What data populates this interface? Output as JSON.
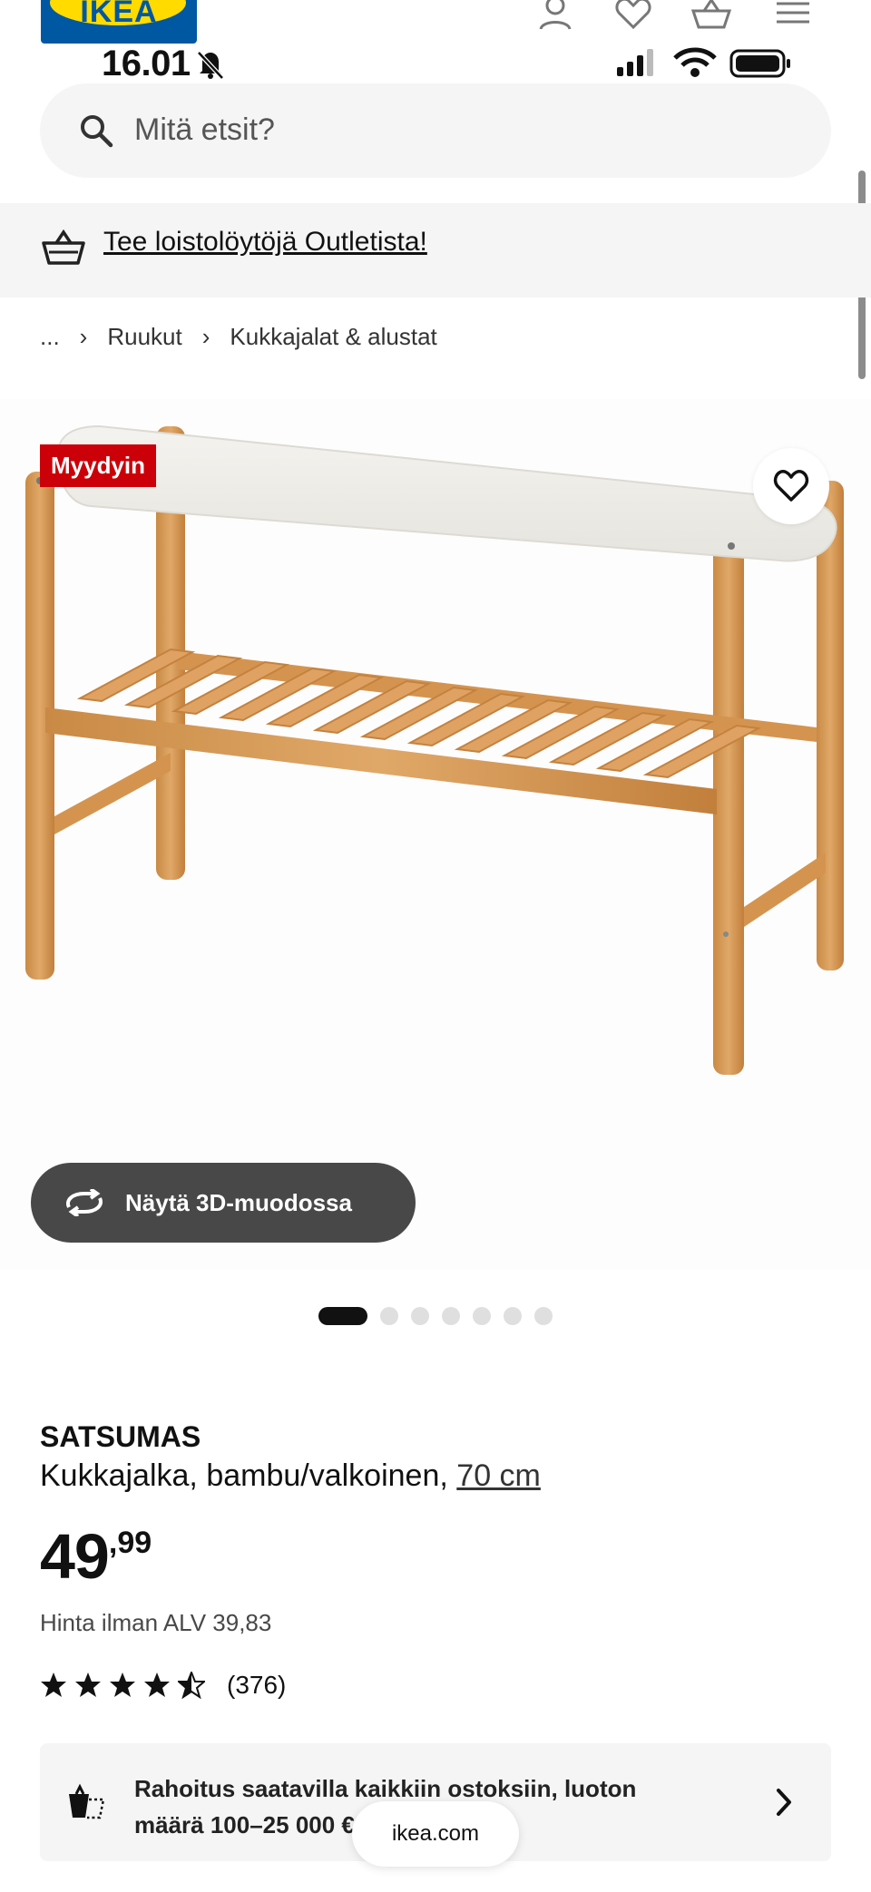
{
  "status_bar": {
    "time": "16.01"
  },
  "header": {
    "logo_text": "IKEA"
  },
  "search": {
    "placeholder": "Mitä etsit?"
  },
  "promo": {
    "text": "Tee loistolöytöjä Outletista!"
  },
  "breadcrumb": {
    "items": [
      "...",
      "Ruukut",
      "Kukkajalat & alustat"
    ]
  },
  "gallery": {
    "badge": "Myydyin",
    "view_3d_label": "Näytä 3D-muodossa",
    "image_count": 7,
    "active_index": 0
  },
  "product": {
    "name": "SATSUMAS",
    "description": "Kukkajalka, bambu/valkoinen,",
    "size_link": "70 cm",
    "price_int": "49",
    "price_dec": ",99",
    "vat_text": "Hinta ilman ALV 39,83",
    "rating_stars": 4.5,
    "review_count": "(376)"
  },
  "finance": {
    "text": "Rahoitus saatavilla kaikkiin ostoksiin, luoton määrä 100–25 000 €"
  },
  "browser": {
    "url_pill": "ikea.com"
  },
  "colors": {
    "ikea_blue": "#0058a3",
    "ikea_yellow": "#ffdb00",
    "badge_red": "#cc0008",
    "button_dark": "#484848"
  }
}
